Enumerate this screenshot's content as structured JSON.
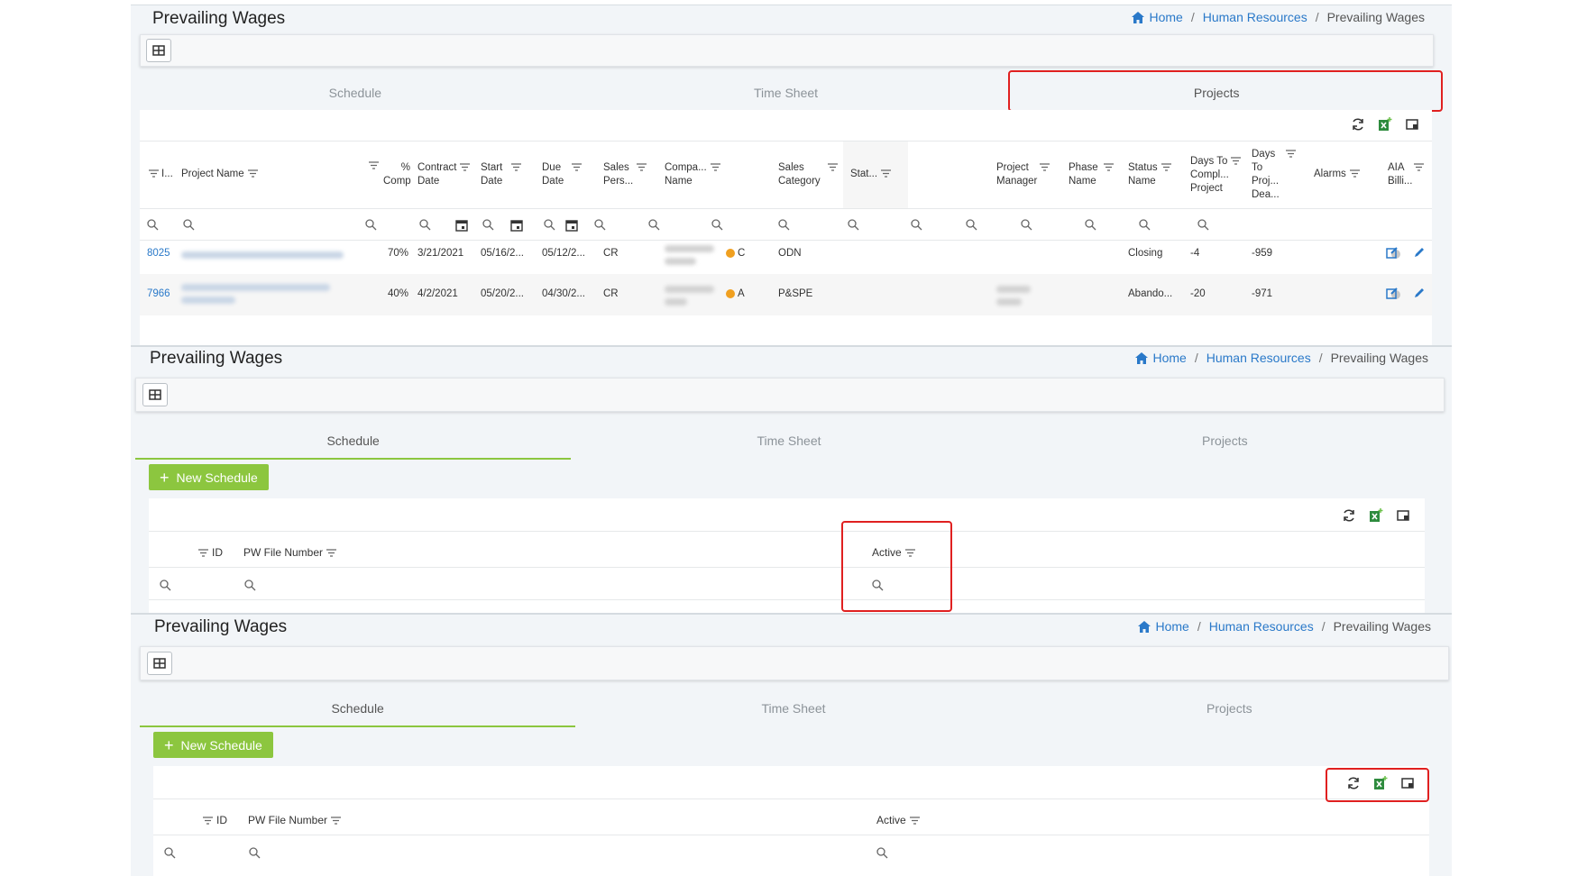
{
  "page_title": "Prevailing Wages",
  "breadcrumb": {
    "home": "Home",
    "section": "Human Resources",
    "current": "Prevailing Wages"
  },
  "tabs": [
    "Schedule",
    "Time Sheet",
    "Projects"
  ],
  "new_schedule_label": "New Schedule",
  "projects_grid": {
    "headers": {
      "id": "I...",
      "project_name": "Project Name",
      "pct_comp": [
        "%",
        "Comp"
      ],
      "contract_date": [
        "Contract",
        "Date"
      ],
      "start_date": [
        "Start",
        "Date"
      ],
      "due_date": [
        "Due",
        "Date"
      ],
      "sales_person": [
        "Sales",
        "Pers..."
      ],
      "company_name": [
        "Compa...",
        "Name"
      ],
      "status": "Stat...",
      "sales_category": [
        "Sales",
        "Category"
      ],
      "project_manager": [
        "Project",
        "Manager"
      ],
      "phase_name": [
        "Phase",
        "Name"
      ],
      "status_name": [
        "Status",
        "Name"
      ],
      "days_to_compl": [
        "Days To",
        "Compl...",
        "Project"
      ],
      "days_to_proj": [
        "Days",
        "To",
        "Proj...",
        "Dea..."
      ],
      "alarms": "Alarms",
      "aia_billing": [
        "AIA",
        "Billi..."
      ]
    },
    "rows": [
      {
        "id": "8025",
        "pct": "70%",
        "contract": "3/21/2021",
        "start": "05/16/2...",
        "due": "05/12/2...",
        "sales_person": "CR",
        "status": "C",
        "sales_category": "ODN",
        "status_name": "Closing",
        "days_to_compl": "-4",
        "days_to_proj": "-959"
      },
      {
        "id": "7966",
        "pct": "40%",
        "contract": "4/2/2021",
        "start": "05/20/2...",
        "due": "04/30/2...",
        "sales_person": "CR",
        "status": "A",
        "sales_category": "P&SPE",
        "status_name": "Abando...",
        "days_to_compl": "-20",
        "days_to_proj": "-971"
      }
    ]
  },
  "schedule_grid": {
    "headers": {
      "id": "ID",
      "pw_file_number": "PW File Number",
      "active": "Active"
    }
  },
  "colors": {
    "accent_green": "#8cc63f",
    "link_blue": "#2a79c9",
    "highlight_red": "#e02020",
    "status_orange": "#f0a020"
  },
  "icons": [
    "table-icon",
    "refresh-icon",
    "excel-export-icon",
    "column-chooser-icon",
    "search-icon",
    "filter-icon",
    "calendar-icon",
    "edit-icon",
    "pencil-icon",
    "home-icon"
  ]
}
